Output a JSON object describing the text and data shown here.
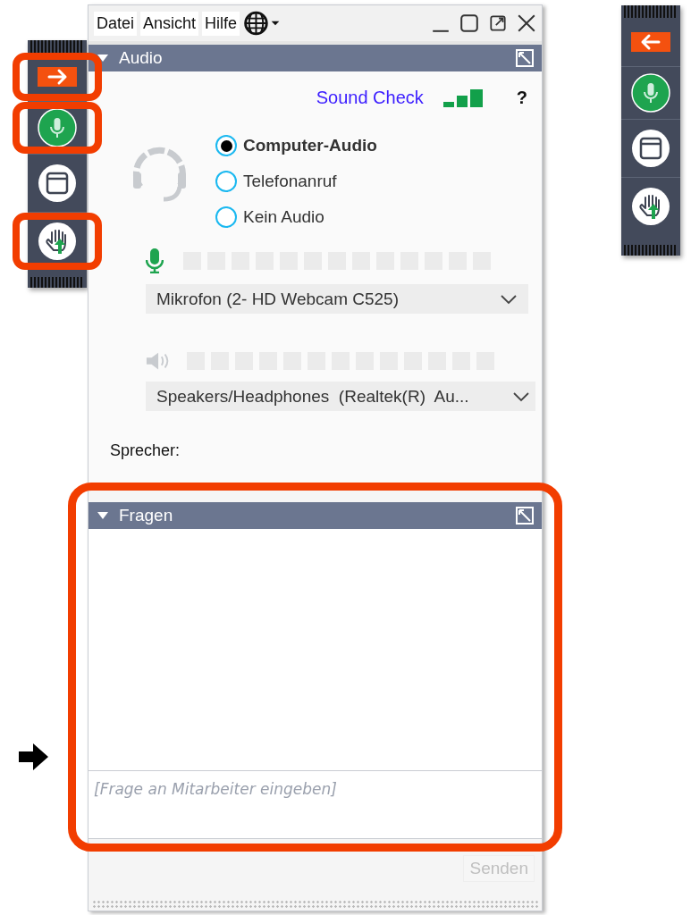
{
  "control_panel": {
    "menu": [
      {
        "label": "Datei"
      },
      {
        "label": "Ansicht"
      },
      {
        "label": "Hilfe"
      }
    ],
    "audio": {
      "title": "Audio",
      "expanded": true,
      "sound_check": "Sound Check",
      "help": "?",
      "modes": [
        {
          "label": "Computer-Audio",
          "selected": true
        },
        {
          "label": "Telefonanruf",
          "selected": false
        },
        {
          "label": "Kein Audio",
          "selected": false
        }
      ],
      "microphone": {
        "device": "Mikrofon (2- HD Webcam C525)"
      },
      "speaker": {
        "device": "Speakers/Headphones  (Realtek(R)  Au..."
      },
      "speaker_label": "Sprecher:"
    },
    "questions": {
      "title": "Fragen",
      "expanded": true,
      "highlighted": true,
      "input": {
        "placeholder": "[Frage an Mitarbeiter eingeben]"
      },
      "send": {
        "label": "Senden",
        "disabled": true
      }
    }
  },
  "toolbars": [
    {
      "items": [
        {
          "kind": "expand",
          "highlighted": true
        },
        {
          "kind": "microphone",
          "highlighted": true
        },
        {
          "kind": "window",
          "highlighted": false
        },
        {
          "kind": "hand",
          "highlighted": true
        }
      ]
    },
    {
      "items": [
        {
          "kind": "collapse",
          "highlighted": false
        },
        {
          "kind": "microphone",
          "highlighted": false
        },
        {
          "kind": "window",
          "highlighted": false
        },
        {
          "kind": "hand",
          "highlighted": false
        }
      ]
    }
  ]
}
